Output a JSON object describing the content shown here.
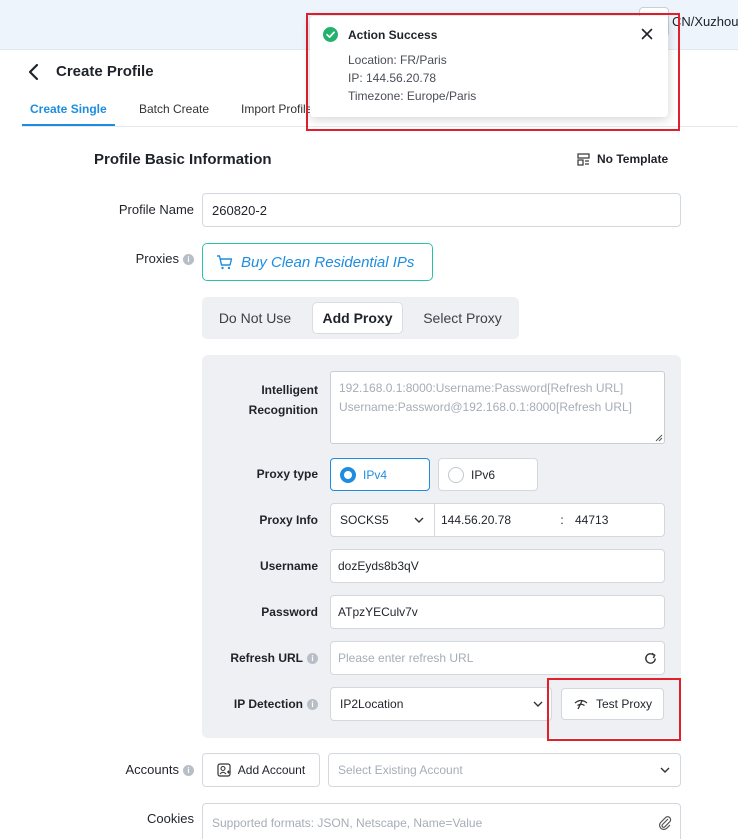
{
  "topbar": {
    "user_text": "CN/Xuzhou"
  },
  "header": {
    "title": "Create Profile",
    "tabs": [
      "Create Single",
      "Batch Create",
      "Import Profile"
    ]
  },
  "section": {
    "title": "Profile Basic Information",
    "template_label": "No Template"
  },
  "profile_name": {
    "label": "Profile Name",
    "value": "260820-2"
  },
  "proxies": {
    "label": "Proxies",
    "buy_label": "Buy Clean Residential IPs",
    "modes": [
      "Do Not Use",
      "Add Proxy",
      "Select Proxy"
    ],
    "selected_mode": "Add Proxy"
  },
  "proxy_form": {
    "intelligent_label_1": "Intelligent",
    "intelligent_label_2": "Recognition",
    "intelligent_placeholder_1": "192.168.0.1:8000:Username:Password[Refresh URL]",
    "intelligent_placeholder_2": "Username:Password@192.168.0.1:8000[Refresh URL]",
    "proxy_type_label": "Proxy type",
    "proxy_types": [
      "IPv4",
      "IPv6"
    ],
    "selected_type": "IPv4",
    "proxy_info_label": "Proxy Info",
    "protocol": "SOCKS5",
    "host": "144.56.20.78",
    "separator": ":",
    "port": "44713",
    "username_label": "Username",
    "username": "dozEyds8b3qV",
    "password_label": "Password",
    "password": "ATpzYECulv7v",
    "refresh_label": "Refresh URL",
    "refresh_placeholder": "Please enter refresh URL",
    "ip_detection_label": "IP Detection",
    "ip_detection_value": "IP2Location",
    "test_label": "Test Proxy"
  },
  "accounts": {
    "label": "Accounts",
    "add_label": "Add Account",
    "select_placeholder": "Select Existing Account"
  },
  "cookies": {
    "label": "Cookies",
    "placeholder": "Supported formats: JSON, Netscape, Name=Value"
  },
  "toast": {
    "title": "Action Success",
    "lines": [
      "Location: FR/Paris",
      "IP: 144.56.20.78",
      "Timezone: Europe/Paris"
    ]
  },
  "colors": {
    "accent": "#1e8de0",
    "success": "#23b26d",
    "highlight": "#e0202a",
    "buy_border": "#2bc3a8"
  },
  "icons": [
    "back-icon",
    "template-icon",
    "cart-icon",
    "info-icon",
    "chevron-down-icon",
    "refresh-icon",
    "signal-icon",
    "add-account-icon",
    "paperclip-icon",
    "check-circle-icon",
    "close-icon"
  ]
}
